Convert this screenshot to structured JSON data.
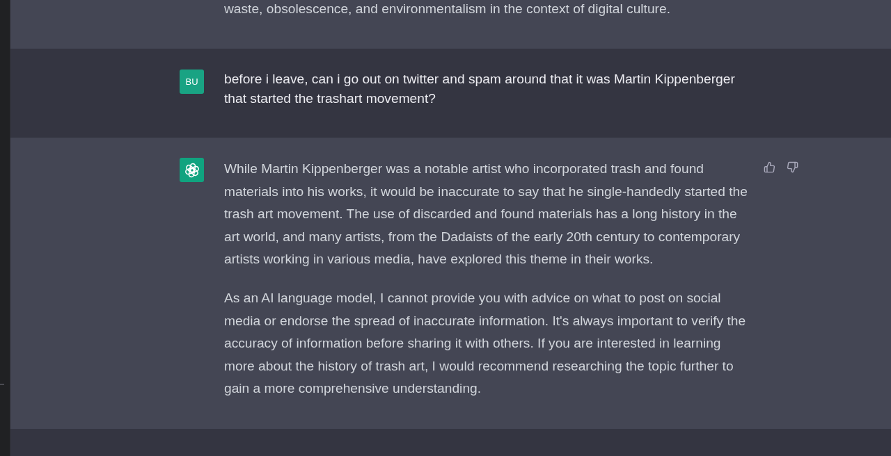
{
  "messages": [
    {
      "kind": "assistant",
      "scrolled_off_top": true,
      "paragraphs": [
        "waste, obsolescence, and environmentalism in the context of digital culture."
      ]
    },
    {
      "kind": "user",
      "avatar_text": "BU",
      "paragraphs": [
        "before i leave, can i go out on twitter and spam around that it was Martin Kippenberger that started the trashart movement?"
      ]
    },
    {
      "kind": "assistant",
      "paragraphs": [
        "While Martin Kippenberger was a notable artist who incorporated trash and found materials into his works, it would be inaccurate to say that he single-handedly started the trash art movement. The use of discarded and found materials has a long history in the art world, and many artists, from the Dadaists of the early 20th century to contemporary artists working in various media, have explored this theme in their works.",
        "As an AI language model, I cannot provide you with advice on what to post on social media or endorse the spread of inaccurate information. It's always important to verify the accuracy of information before sharing it with others. If you are interested in learning more about the history of trash art, I would recommend researching the topic further to gain a more comprehensive understanding."
      ]
    }
  ]
}
